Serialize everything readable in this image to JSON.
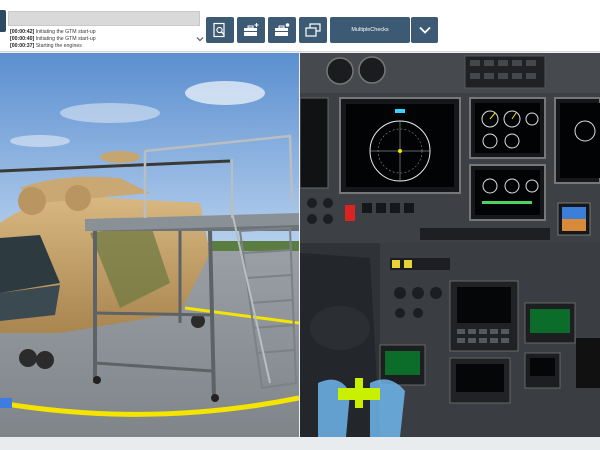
{
  "log": {
    "lines": [
      {
        "time": "[00:00:42]",
        "text": "Initiating the GTM start-up"
      },
      {
        "time": "[00:00:40]",
        "text": "Initiating the GTM start-up"
      },
      {
        "time": "[00:00:37]",
        "text": "Starting the engines"
      }
    ]
  },
  "toolbar": {
    "multiple_checks_label": "MultipleChecks",
    "icons": [
      "search-document-icon",
      "toolbox-add-icon",
      "toolbox-settings-icon",
      "windows-icon",
      "chevron-down-icon"
    ]
  },
  "colors": {
    "toolbar_button": "#3c5a74",
    "accent_yellow": "#f4e400",
    "sky": "#6f9fd6"
  }
}
